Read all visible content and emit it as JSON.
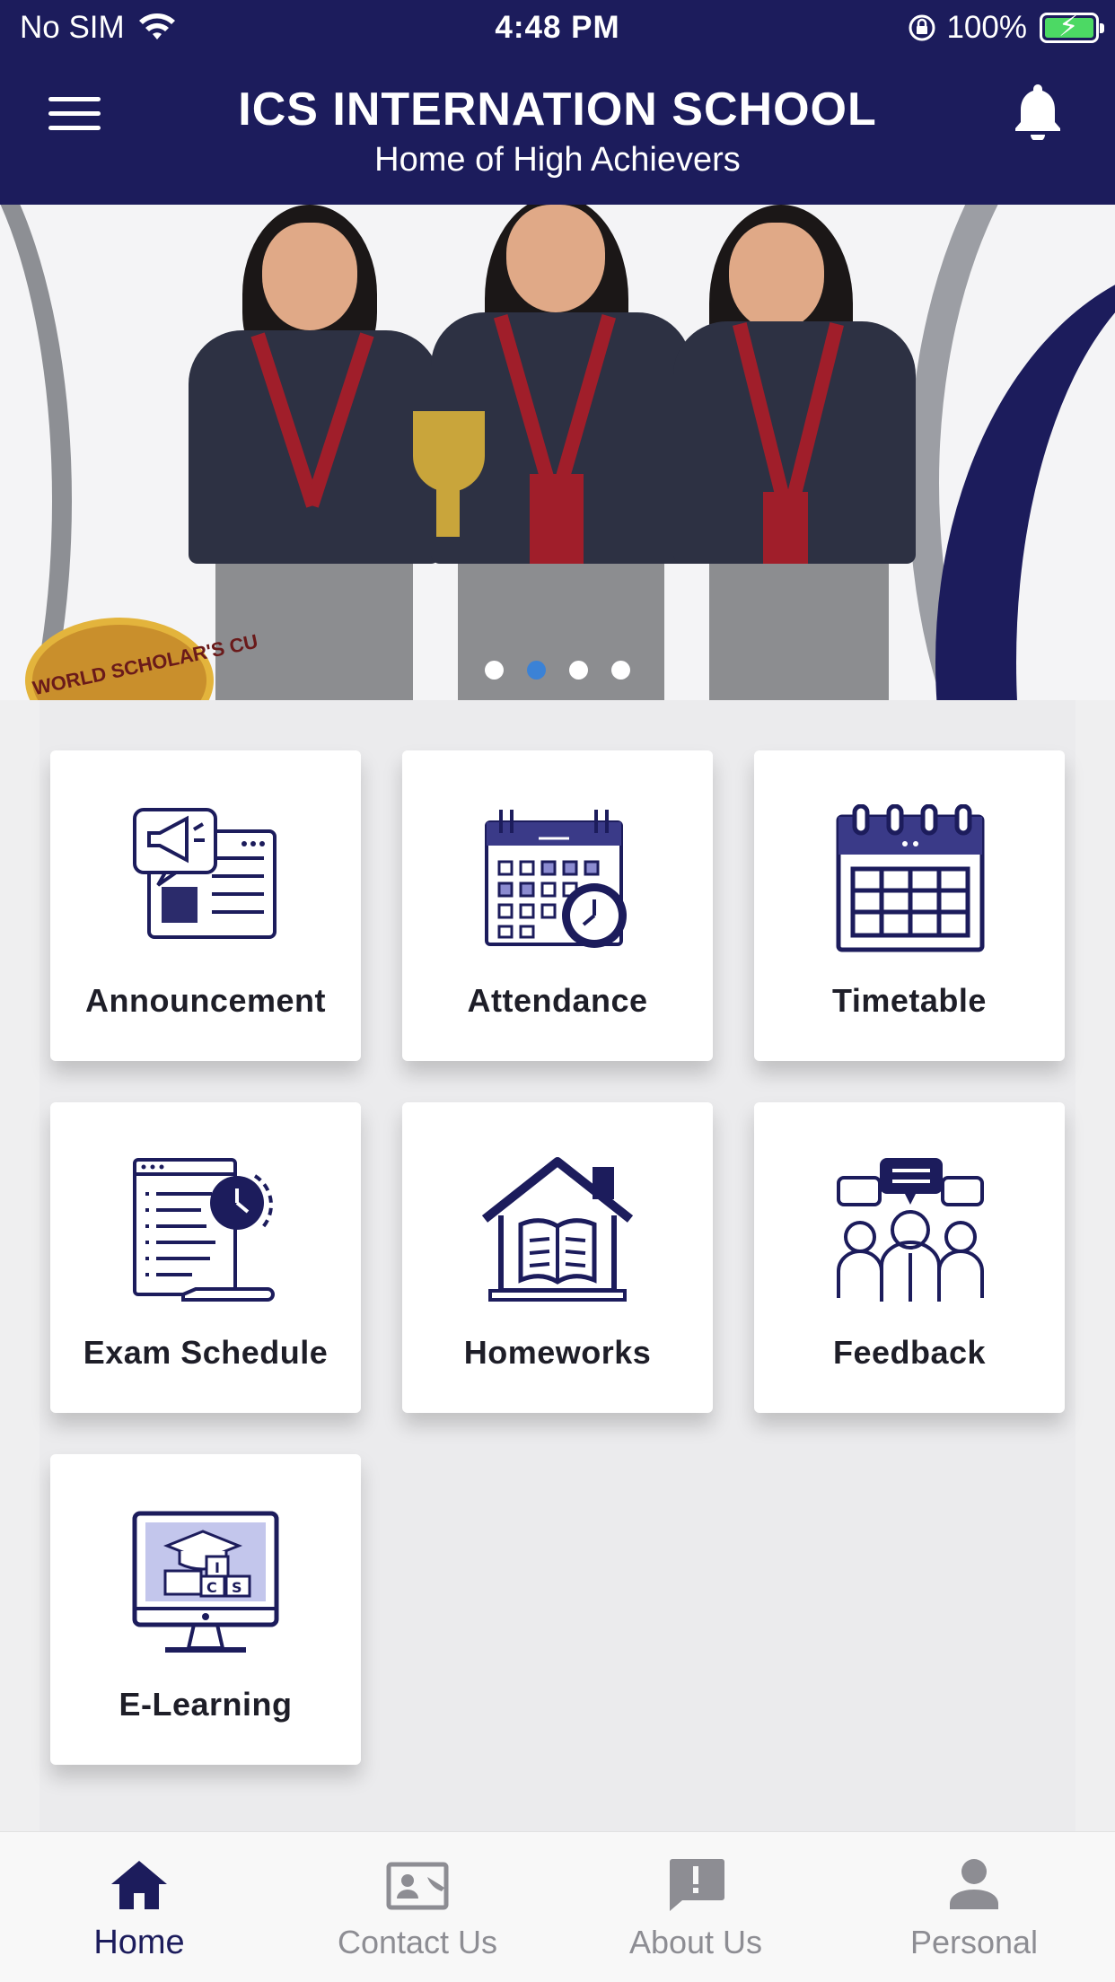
{
  "status_bar": {
    "carrier": "No SIM",
    "time": "4:48 PM",
    "battery": "100%"
  },
  "header": {
    "title": "ICS INTERNATION SCHOOL",
    "subtitle": "Home of High Achievers"
  },
  "banner": {
    "seal_text": "WORLD SCHOLAR'S CU",
    "slides_total": 4,
    "active_slide": 2
  },
  "tiles": [
    {
      "label": "Announcement",
      "icon": "megaphone-icon"
    },
    {
      "label": "Attendance",
      "icon": "calendar-clock-icon"
    },
    {
      "label": "Timetable",
      "icon": "calendar-icon"
    },
    {
      "label": "Exam Schedule",
      "icon": "document-clock-icon"
    },
    {
      "label": "Homeworks",
      "icon": "house-book-icon"
    },
    {
      "label": "Feedback",
      "icon": "people-chat-icon"
    },
    {
      "label": "E-Learning",
      "icon": "monitor-graduation-icon"
    }
  ],
  "bottom_nav": [
    {
      "label": "Home",
      "icon": "home-icon",
      "active": true
    },
    {
      "label": "Contact Us",
      "icon": "contact-card-icon",
      "active": false
    },
    {
      "label": "About Us",
      "icon": "info-bubble-icon",
      "active": false
    },
    {
      "label": "Personal",
      "icon": "person-icon",
      "active": false
    }
  ],
  "colors": {
    "brand_navy": "#1c1c5c",
    "dot_active": "#3b82d6",
    "battery_green": "#4cd964"
  }
}
